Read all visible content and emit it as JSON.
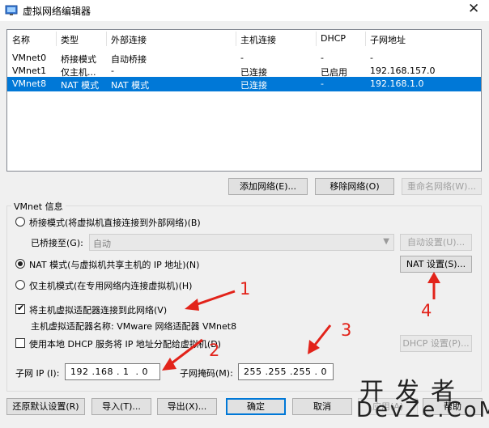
{
  "window": {
    "title": "虚拟网络编辑器",
    "close": "✕"
  },
  "table": {
    "columns": [
      "名称",
      "类型",
      "外部连接",
      "主机连接",
      "DHCP",
      "子网地址"
    ],
    "rows": [
      [
        "VMnet0",
        "桥接模式",
        "自动桥接",
        "-",
        "-",
        "-"
      ],
      [
        "VMnet1",
        "仅主机...",
        "-",
        "已连接",
        "已启用",
        "192.168.157.0"
      ],
      [
        "VMnet8",
        "NAT 模式",
        "NAT 模式",
        "已连接",
        "-",
        "192.168.1.0"
      ]
    ],
    "selected_row": 2,
    "selection_color": "#0078d7"
  },
  "table_buttons": {
    "add": "添加网络(E)...",
    "remove": "移除网络(O)",
    "rename": "重命名网络(W)..."
  },
  "vmnet_info": {
    "group_label": "VMnet 信息",
    "bridged_label": "桥接模式(将虚拟机直接连接到外部网络)(B)",
    "bridged_to_label": "已桥接至(G):",
    "bridged_to_value": "自动",
    "auto_settings": "自动设置(U)...",
    "nat_label": "NAT 模式(与虚拟机共享主机的 IP 地址)(N)",
    "nat_settings": "NAT 设置(S)...",
    "hostonly_label": "仅主机模式(在专用网络内连接虚拟机)(H)",
    "selected_mode": "nat",
    "connect_adapter_label": "将主机虚拟适配器连接到此网络(V)",
    "connect_adapter_checked": true,
    "adapter_name_label": "主机虚拟适配器名称: VMware 网络适配器 VMnet8",
    "dhcp_label": "使用本地 DHCP 服务将 IP 地址分配给虚拟机(D)",
    "dhcp_checked": false,
    "dhcp_settings": "DHCP 设置(P)...",
    "subnet_ip_label": "子网 IP (I):",
    "subnet_ip_value": "192 .168 . 1  . 0",
    "subnet_mask_label": "子网掩码(M):",
    "subnet_mask_value": "255 .255 .255 . 0"
  },
  "bottom_buttons": {
    "restore": "还原默认设置(R)",
    "import": "导入(T)...",
    "export": "导出(X)...",
    "ok": "确定",
    "cancel": "取消",
    "apply": "应用(A)",
    "help": "帮助"
  },
  "annotations": {
    "color": "#e2231a",
    "n1": "1",
    "n2": "2",
    "n3": "3",
    "n4": "4"
  },
  "watermark": {
    "line1": "开发者",
    "line2": "DevZe.CoM"
  }
}
